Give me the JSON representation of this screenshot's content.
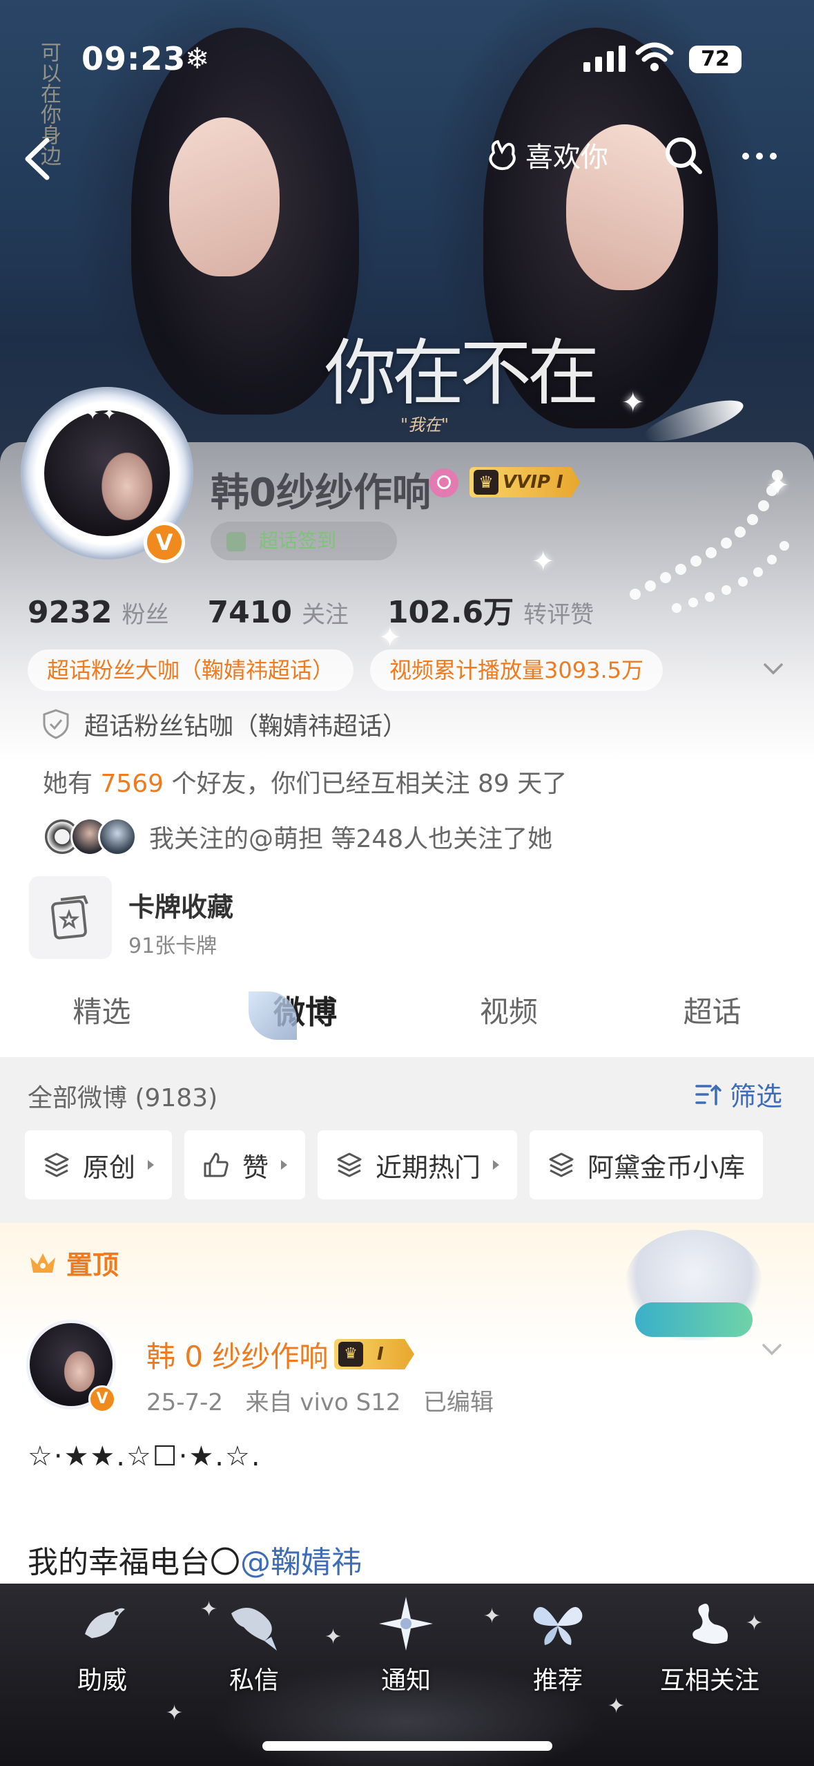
{
  "status_bar": {
    "time": "09:23",
    "weather_icon": "snowflake-icon",
    "battery": "72"
  },
  "banner": {
    "title": "你在不在",
    "subtitle": "\"我在\"",
    "side_text": "可以在你身边"
  },
  "nav": {
    "like_label": "喜欢你"
  },
  "profile": {
    "name": "韩0纱纱作响",
    "vip_label": "VVIP I",
    "super_badge": "超话签到",
    "verified_mark": "V",
    "stats": [
      {
        "value": "9232",
        "label": "粉丝"
      },
      {
        "value": "7410",
        "label": "关注"
      },
      {
        "value": "102.6万",
        "label": "转评赞"
      }
    ],
    "tags": [
      "超话粉丝大咖（鞠婧祎超话）",
      "视频累计播放量3093.5万"
    ],
    "diamond_tag": "超话粉丝钻咖（鞠婧祎超话）",
    "friends_prefix": "她有",
    "friends_count": "7569",
    "friends_suffix": "个好友，你们已经互相关注 89 天了",
    "follows_text": "我关注的@萌担 等248人也关注了她",
    "card_title": "卡牌收藏",
    "card_sub": "91张卡牌"
  },
  "tabs": [
    {
      "label": "精选",
      "active": false
    },
    {
      "label": "微博",
      "active": true
    },
    {
      "label": "视频",
      "active": false
    },
    {
      "label": "超话",
      "active": false
    }
  ],
  "feed": {
    "all_label": "全部微博 (9183)",
    "filter_label": "筛选",
    "chips": [
      {
        "label": "原创",
        "icon": "layers-icon"
      },
      {
        "label": "赞",
        "icon": "thumbs-up-icon"
      },
      {
        "label": "近期热门",
        "icon": "layers-icon"
      },
      {
        "label": "阿黛金币小库",
        "icon": "layers-icon"
      }
    ]
  },
  "pinned_label": "置顶",
  "post": {
    "author": "韩 0 纱纱作响",
    "vip_label": "I",
    "date": "25-7-2",
    "source": "来自 vivo S12",
    "edited": "已编辑",
    "text_line1": "☆·★★.☆☐·★.☆.",
    "text_line2_prefix": "我的幸福电台〇",
    "text_line2_mention": "@鞠婧祎"
  },
  "bottom_bar": [
    {
      "label": "助威",
      "icon": "bird-icon"
    },
    {
      "label": "私信",
      "icon": "fish-icon"
    },
    {
      "label": "通知",
      "icon": "star-flower-icon"
    },
    {
      "label": "推荐",
      "icon": "butterfly-icon"
    },
    {
      "label": "互相关注",
      "icon": "swan-icon"
    }
  ],
  "colors": {
    "accent_orange": "#f07a1e",
    "link_blue": "#3e6cb8",
    "vip_gold": "#f9d56a"
  }
}
